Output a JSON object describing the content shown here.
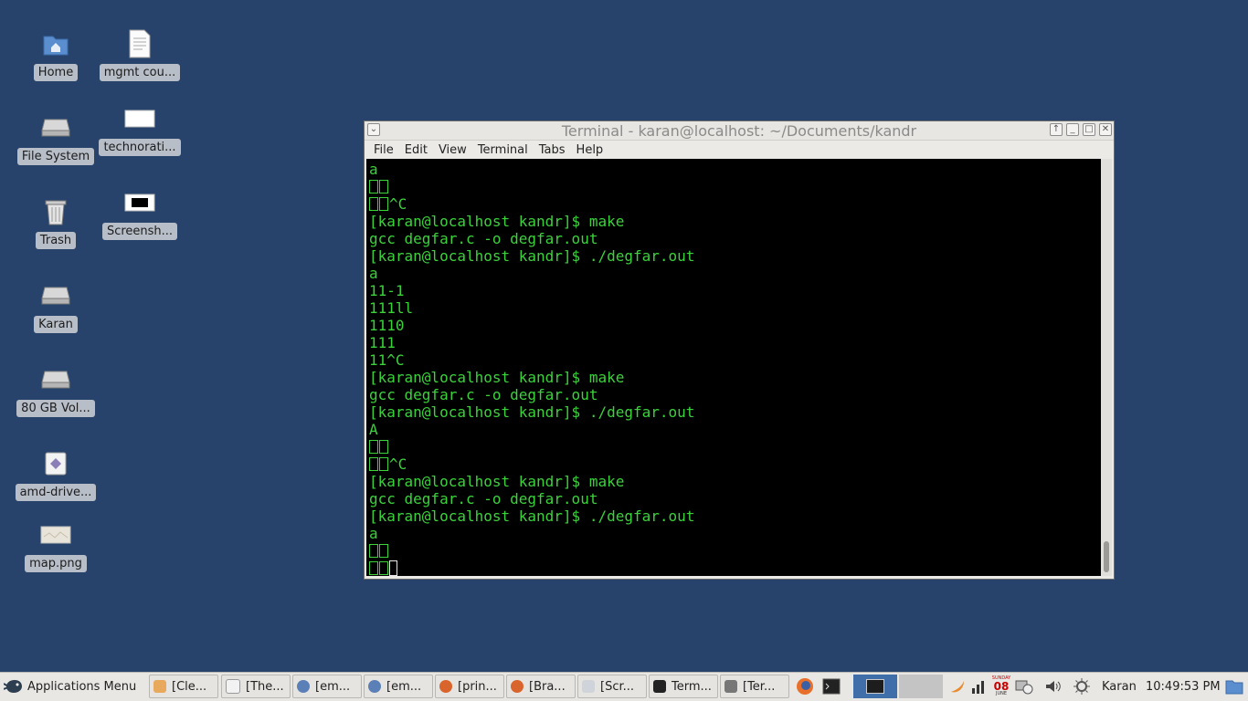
{
  "desktop": {
    "icons": [
      {
        "label": "Home",
        "icon": "home-folder-icon"
      },
      {
        "label": "mgmt cou...",
        "icon": "document-icon"
      },
      {
        "label": "File System",
        "icon": "drive-icon"
      },
      {
        "label": "technorati...",
        "icon": "image-file-icon"
      },
      {
        "label": "Trash",
        "icon": "trash-icon"
      },
      {
        "label": "Screensh...",
        "icon": "screenshot-icon"
      },
      {
        "label": "Karan",
        "icon": "drive-icon"
      },
      {
        "label": "80 GB Vol...",
        "icon": "drive-icon"
      },
      {
        "label": "amd-drive...",
        "icon": "package-icon"
      },
      {
        "label": "map.png",
        "icon": "image-file-icon"
      }
    ]
  },
  "window": {
    "title": "Terminal - karan@localhost: ~/Documents/kandr",
    "menu": [
      "File",
      "Edit",
      "View",
      "Terminal",
      "Tabs",
      "Help"
    ]
  },
  "terminal": {
    "lines": [
      "a",
      "",
      "^C",
      "[karan@localhost kandr]$ make",
      "gcc degfar.c -o degfar.out",
      "[karan@localhost kandr]$ ./degfar.out",
      "a",
      "11-1",
      "111ll",
      "1110",
      "111",
      "11^C",
      "[karan@localhost kandr]$ make",
      "gcc degfar.c -o degfar.out",
      "[karan@localhost kandr]$ ./degfar.out",
      "A",
      "",
      "^C",
      "[karan@localhost kandr]$ make",
      "gcc degfar.c -o degfar.out",
      "[karan@localhost kandr]$ ./degfar.out",
      "a",
      "",
      ""
    ],
    "text_color": "#3bd23b",
    "background": "#000000"
  },
  "taskbar": {
    "apps_menu": "Applications Menu",
    "tasks": [
      "[Cle...",
      "[The...",
      "[em...",
      "[em...",
      "[prin...",
      "[Bra...",
      "[Scr...",
      "Term...",
      "[Ter..."
    ],
    "user": "Karan",
    "clock": "10:49:53 PM",
    "calendar_day": "08",
    "calendar_weekday": "SUNDAY",
    "calendar_month": "JUNE"
  },
  "colors": {
    "desktop_bg": "#27436b",
    "label_bg": "#b8bec8",
    "taskbar_bg": "#e9e7e3"
  }
}
